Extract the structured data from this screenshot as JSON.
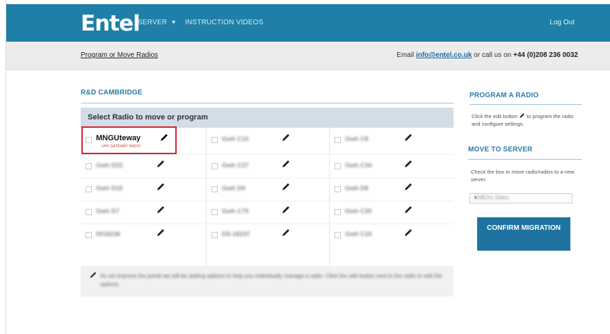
{
  "header": {
    "logo": "Entel",
    "nav_server": "SERVER",
    "nav_server_caret": "▾",
    "nav_videos": "INSTRUCTION VIDEOS",
    "logout": "Log Out"
  },
  "subheader": {
    "breadcrumb": "Program or Move Radios",
    "contact_prefix": "Email",
    "contact_email": "info@entel.co.uk",
    "contact_middle": "or call us on",
    "contact_phone": "+44 (0)208 236 0032"
  },
  "main": {
    "section_title": "R&D CAMBRIDGE",
    "panel_title": "Select Radio to move or program",
    "radios": [
      {
        "name": "MNGUteway",
        "subtitle": "UHF GATEWAY RADIO"
      },
      {
        "name": "Gwh C10",
        "subtitle": ""
      },
      {
        "name": "Gwh C8",
        "subtitle": ""
      },
      {
        "name": "Gwh D22",
        "subtitle": ""
      },
      {
        "name": "Gwh C27",
        "subtitle": ""
      },
      {
        "name": "Gwh C34",
        "subtitle": ""
      },
      {
        "name": "Gwh D16",
        "subtitle": ""
      },
      {
        "name": "Gwh D9",
        "subtitle": ""
      },
      {
        "name": "Gwh D8",
        "subtitle": ""
      },
      {
        "name": "Gwh D7",
        "subtitle": ""
      },
      {
        "name": "Gwh C75",
        "subtitle": ""
      },
      {
        "name": "Gwh C30",
        "subtitle": ""
      },
      {
        "name": "0018236",
        "subtitle": ""
      },
      {
        "name": "DS-18237",
        "subtitle": ""
      },
      {
        "name": "Gwh C16",
        "subtitle": ""
      }
    ],
    "note": "As we improve the portal we will be adding options to help you individually manage a radio. Click the edit button next to the radio to edit the options."
  },
  "sidebar": {
    "program_title": "PROGRAM A RADIO",
    "program_text_a": "Click the edit button",
    "program_text_b": "to program the radio and configure settings.",
    "move_title": "MOVE TO SERVER",
    "move_text": "Check the box to move radio/radios to a new server.",
    "server_select": "EMEA1 Sales",
    "select_caret": "▾",
    "confirm_label": "CONFIRM MIGRATION"
  },
  "colors": {
    "brand_blue": "#1f7fa8",
    "button_blue": "#1f73a0",
    "highlight_red": "#d2242b"
  },
  "icons": {
    "edit": "pencil-icon",
    "checkbox": "checkbox-icon"
  }
}
